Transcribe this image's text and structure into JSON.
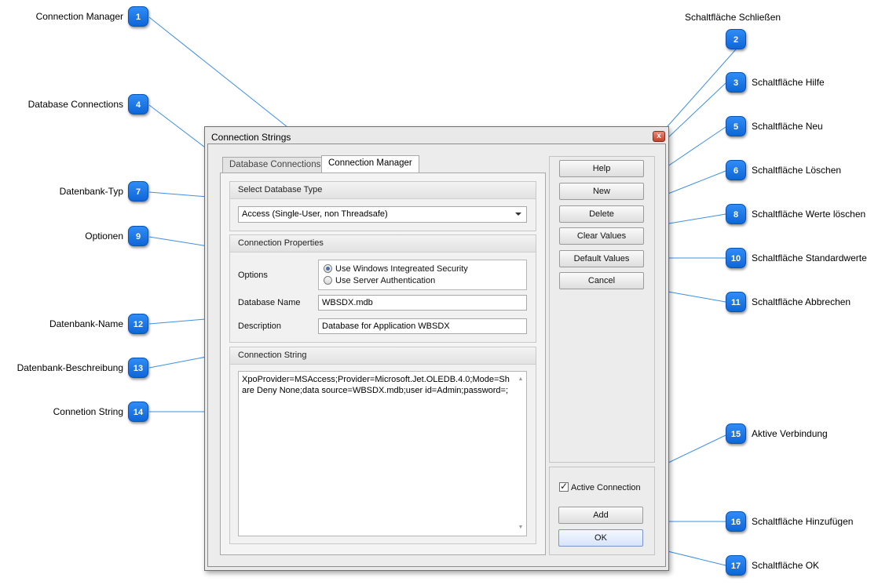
{
  "annotations": [
    {
      "number": "1",
      "label": "Connection Manager"
    },
    {
      "number": "2",
      "label": "Schaltfläche Schließen"
    },
    {
      "number": "3",
      "label": "Schaltfläche Hilfe"
    },
    {
      "number": "4",
      "label": "Database Connections"
    },
    {
      "number": "5",
      "label": "Schaltfläche Neu"
    },
    {
      "number": "6",
      "label": "Schaltfläche Löschen"
    },
    {
      "number": "7",
      "label": "Datenbank-Typ"
    },
    {
      "number": "8",
      "label": "Schaltfläche Werte löschen"
    },
    {
      "number": "9",
      "label": "Optionen"
    },
    {
      "number": "10",
      "label": "Schaltfläche Standardwerte"
    },
    {
      "number": "11",
      "label": "Schaltfläche Abbrechen"
    },
    {
      "number": "12",
      "label": "Datenbank-Name"
    },
    {
      "number": "13",
      "label": "Datenbank-Beschreibung"
    },
    {
      "number": "14",
      "label": "Connetion String"
    },
    {
      "number": "15",
      "label": "Aktive Verbindung"
    },
    {
      "number": "16",
      "label": "Schaltfläche Hinzufügen"
    },
    {
      "number": "17",
      "label": "Schaltfläche OK"
    }
  ],
  "dialog": {
    "title": "Connection Strings",
    "close_glyph": "x",
    "tabs": [
      "Database Connections",
      "Connection Manager"
    ],
    "active_tab": "Connection Manager",
    "select_db_type": {
      "header": "Select Database Type",
      "value": "Access (Single-User, non Threadsafe)"
    },
    "connection_properties": {
      "header": "Connection Properties",
      "options_label": "Options",
      "options": [
        {
          "label": "Use Windows Integreated Security",
          "checked": true
        },
        {
          "label": "Use Server Authentication",
          "checked": false
        }
      ],
      "db_name_label": "Database Name",
      "db_name_value": "WBSDX.mdb",
      "description_label": "Description",
      "description_value": "Database for Application WBSDX"
    },
    "connection_string": {
      "header": "Connection String",
      "value": "XpoProvider=MSAccess;Provider=Microsoft.Jet.OLEDB.4.0;Mode=Share Deny None;data source=WBSDX.mdb;user id=Admin;password=;",
      "scroll_up": "▲",
      "scroll_down": "▼"
    },
    "buttons": {
      "help": "Help",
      "new": "New",
      "delete": "Delete",
      "clear_values": "Clear Values",
      "default_values": "Default Values",
      "cancel": "Cancel",
      "add": "Add",
      "ok": "OK"
    },
    "active_connection": {
      "label": "Active Connection",
      "checked": true
    }
  }
}
